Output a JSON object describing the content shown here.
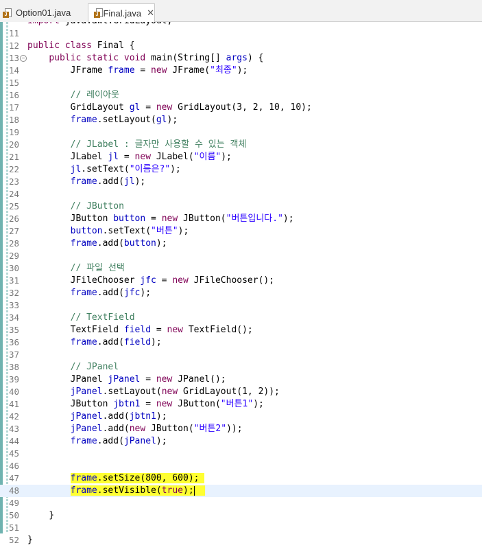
{
  "tabs": [
    {
      "label": "Option01.java",
      "active": false
    },
    {
      "label": "Final.java",
      "active": true
    }
  ],
  "tab_close_glyph": "✕",
  "fold_glyph": "⊖",
  "editor": {
    "top_partial_line": "import java.awt.GridLayout;",
    "lines": [
      {
        "num": "11",
        "text": ""
      },
      {
        "num": "12",
        "text": "public class Final {"
      },
      {
        "num": "13",
        "text": "    public static void main(String[] args) {"
      },
      {
        "num": "14",
        "text": "        JFrame frame = new JFrame(\"최종\");"
      },
      {
        "num": "15",
        "text": ""
      },
      {
        "num": "16",
        "text": "        // 레이아웃"
      },
      {
        "num": "17",
        "text": "        GridLayout gl = new GridLayout(3, 2, 10, 10);"
      },
      {
        "num": "18",
        "text": "        frame.setLayout(gl);"
      },
      {
        "num": "19",
        "text": ""
      },
      {
        "num": "20",
        "text": "        // JLabel : 글자만 사용할 수 있는 객체"
      },
      {
        "num": "21",
        "text": "        JLabel jl = new JLabel(\"이름\");"
      },
      {
        "num": "22",
        "text": "        jl.setText(\"이름은?\");"
      },
      {
        "num": "23",
        "text": "        frame.add(jl);"
      },
      {
        "num": "24",
        "text": ""
      },
      {
        "num": "25",
        "text": "        // JButton"
      },
      {
        "num": "26",
        "text": "        JButton button = new JButton(\"버튼입니다.\");"
      },
      {
        "num": "27",
        "text": "        button.setText(\"버튼\");"
      },
      {
        "num": "28",
        "text": "        frame.add(button);"
      },
      {
        "num": "29",
        "text": ""
      },
      {
        "num": "30",
        "text": "        // 파일 선택"
      },
      {
        "num": "31",
        "text": "        JFileChooser jfc = new JFileChooser();"
      },
      {
        "num": "32",
        "text": "        frame.add(jfc);"
      },
      {
        "num": "33",
        "text": ""
      },
      {
        "num": "34",
        "text": "        // TextField"
      },
      {
        "num": "35",
        "text": "        TextField field = new TextField();"
      },
      {
        "num": "36",
        "text": "        frame.add(field);"
      },
      {
        "num": "37",
        "text": ""
      },
      {
        "num": "38",
        "text": "        // JPanel"
      },
      {
        "num": "39",
        "text": "        JPanel jPanel = new JPanel();"
      },
      {
        "num": "40",
        "text": "        jPanel.setLayout(new GridLayout(1, 2));"
      },
      {
        "num": "41",
        "text": "        JButton jbtn1 = new JButton(\"버튼1\");"
      },
      {
        "num": "42",
        "text": "        jPanel.add(jbtn1);"
      },
      {
        "num": "43",
        "text": "        jPanel.add(new JButton(\"버튼2\"));"
      },
      {
        "num": "44",
        "text": "        frame.add(jPanel);"
      },
      {
        "num": "45",
        "text": ""
      },
      {
        "num": "46",
        "text": ""
      },
      {
        "num": "47",
        "text": "        frame.setSize(800, 600);"
      },
      {
        "num": "48",
        "text": "        frame.setVisible(true);"
      },
      {
        "num": "49",
        "text": ""
      },
      {
        "num": "50",
        "text": "    }"
      },
      {
        "num": "51",
        "text": ""
      },
      {
        "num": "52",
        "text": "}"
      }
    ]
  },
  "colors": {
    "keyword": "#7f0055",
    "string": "#2a00ff",
    "comment": "#3f7f5f",
    "field": "#0000c0",
    "highlight_marker": "#ffff32",
    "current_line": "#e8f2fe"
  }
}
